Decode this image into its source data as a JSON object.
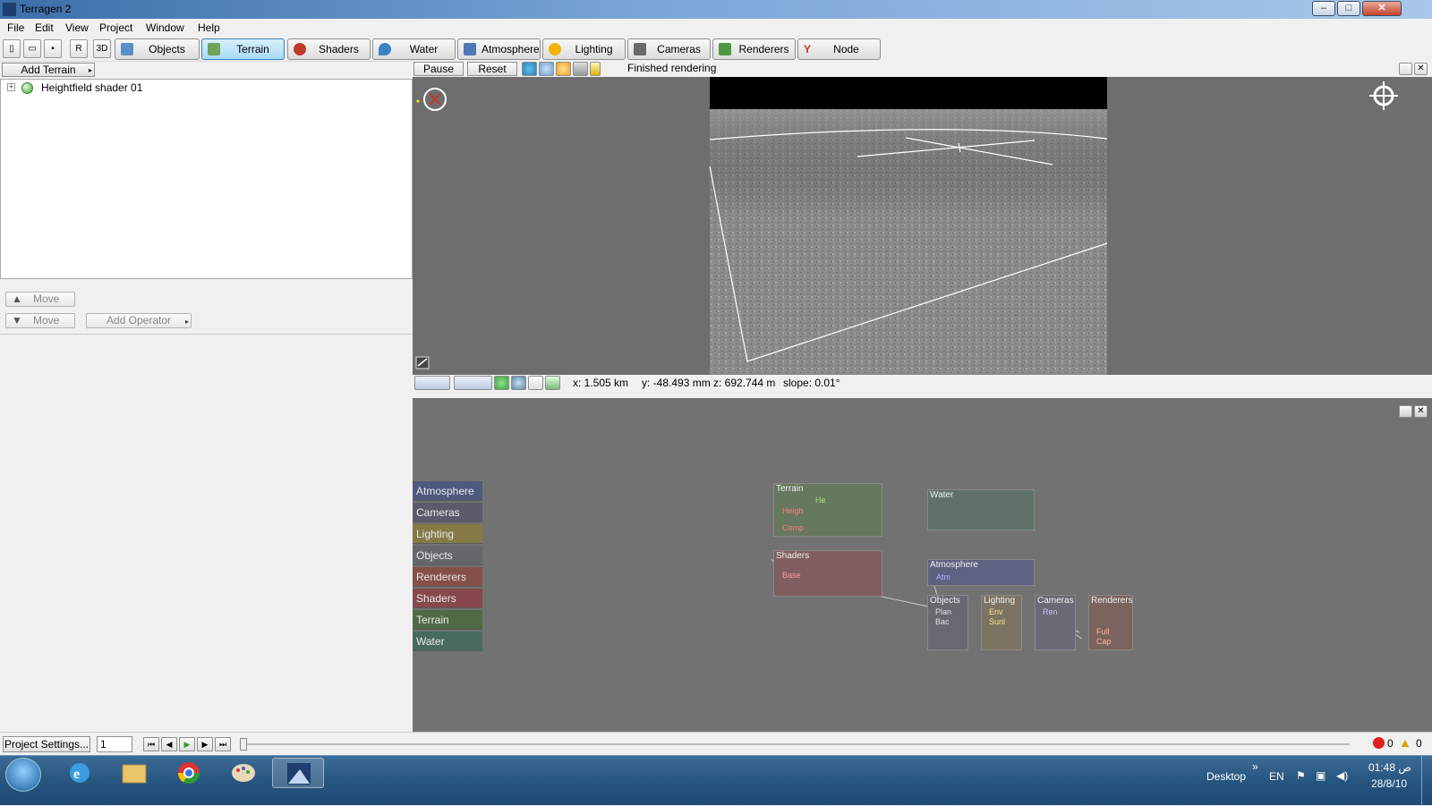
{
  "window": {
    "title": "Terragen 2"
  },
  "menu": {
    "items": [
      "File",
      "Edit",
      "View",
      "Project",
      "Window",
      "Help"
    ]
  },
  "toolbar": {
    "tabs": [
      {
        "label": "Objects",
        "color": "#5a8fc7"
      },
      {
        "label": "Terrain",
        "color": "#6ea35a"
      },
      {
        "label": "Shaders",
        "color": "#c0392b"
      },
      {
        "label": "Water",
        "color": "#3b82c4"
      },
      {
        "label": "Atmosphere",
        "color": "#4d78b5"
      },
      {
        "label": "Lighting",
        "color": "#f0b400"
      },
      {
        "label": "Cameras",
        "color": "#6a6a6a"
      },
      {
        "label": "Renderers",
        "color": "#4f9a40"
      },
      {
        "label": "Node Network",
        "color": "#c0392b"
      }
    ],
    "active_tab": "Terrain"
  },
  "left_panel": {
    "add_terrain_label": "Add Terrain",
    "tree_items": [
      {
        "label": "Heightfield shader 01"
      }
    ],
    "move_up_label": "Move",
    "move_down_label": "Move",
    "add_operator_label": "Add Operator"
  },
  "viewport": {
    "pause_label": "Pause",
    "reset_label": "Reset",
    "status": "Finished rendering",
    "coords": {
      "x": "x: 1.505 km",
      "y": "y: -48.493 mm",
      "z": "z: 692.744 m",
      "slope": "slope: 0.01°"
    }
  },
  "node_network": {
    "categories": [
      {
        "label": "Atmosphere",
        "color": "#4e5980"
      },
      {
        "label": "Cameras",
        "color": "#5b5c6b"
      },
      {
        "label": "Lighting",
        "color": "#857946"
      },
      {
        "label": "Objects",
        "color": "#66676d"
      },
      {
        "label": "Renderers",
        "color": "#855047"
      },
      {
        "label": "Shaders",
        "color": "#86484c"
      },
      {
        "label": "Terrain",
        "color": "#4e6b45"
      },
      {
        "label": "Water",
        "color": "#466b5e"
      }
    ],
    "groups": {
      "terrain": {
        "title": "Terrain",
        "ports": [
          "He",
          "Heigh",
          "Comp"
        ]
      },
      "water": {
        "title": "Water"
      },
      "shaders": {
        "title": "Shaders",
        "ports": [
          "Base"
        ]
      },
      "atmosphere": {
        "title": "Atmosphere",
        "ports": [
          "Atm"
        ]
      },
      "objects": {
        "title": "Objects",
        "ports": [
          "Plan",
          "Bac"
        ]
      },
      "lighting": {
        "title": "Lighting",
        "ports": [
          "Env",
          "Sunl"
        ]
      },
      "cameras": {
        "title": "Cameras",
        "ports": [
          "Ren"
        ]
      },
      "renderers": {
        "title": "Renderers",
        "ports": [
          "Full",
          "Cap"
        ]
      }
    }
  },
  "timeline": {
    "project_settings_label": "Project Settings...",
    "frame": "1",
    "errors": "0",
    "warnings": "0"
  },
  "taskbar": {
    "desktop_label": "Desktop",
    "chevron": "»",
    "lang": "EN",
    "time": "01:48 ص",
    "date": "28/8/10"
  }
}
